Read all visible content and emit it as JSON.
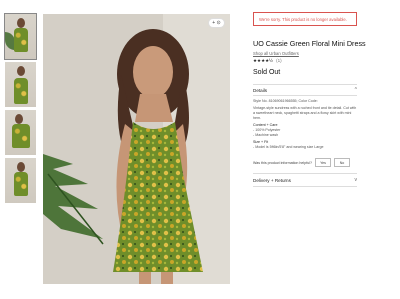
{
  "gallery": {
    "thumbnails": [
      {
        "label": "thumbnail 1"
      },
      {
        "label": "thumbnail 2"
      },
      {
        "label": "thumbnail 3"
      },
      {
        "label": "thumbnail 4"
      }
    ],
    "zoom_label": "+ ⊙"
  },
  "product": {
    "alert": "We're sorry. This product is no longer available.",
    "title": "UO Cassie Green Floral Mini Dress",
    "shop_link": "Shop all Urban Outfitters",
    "stars": "★★★★½",
    "rating_count": "(1)",
    "status": "Sold Out"
  },
  "details": {
    "heading": "Details",
    "caret": "^",
    "style_line": "Style No. 81069061966555; Color Code:",
    "description": "Vintage-style sundress with a ruched front and tie detail. Cut with a sweetheart neck, spaghetti straps and a flowy skirt with mini hem.",
    "content_heading": "Content + Care",
    "content_lines": [
      "- 100% Polyester",
      "- Machine wash"
    ],
    "fit_heading": "Size + Fit",
    "fit_lines": [
      "- Model is 5ft6in/5'8\" and wearing size Large"
    ],
    "helpful_question": "Was this product information helpful?",
    "yes_label": "Yes",
    "no_label": "No"
  },
  "delivery": {
    "heading": "Delivery + Returns",
    "caret": "v"
  },
  "colors": {
    "alert": "#d9534f",
    "dress_green": "#6f8e2a",
    "dress_yellow": "#e0c048"
  }
}
